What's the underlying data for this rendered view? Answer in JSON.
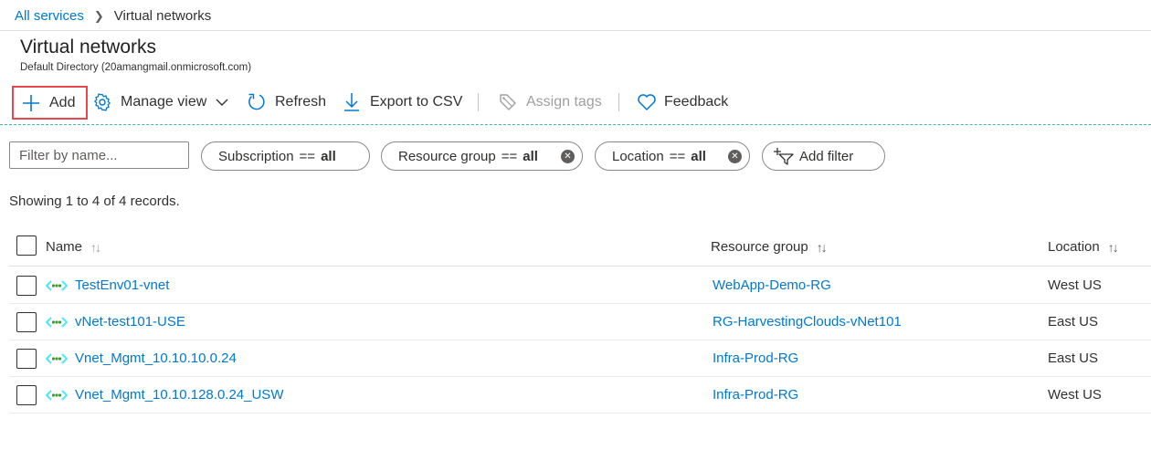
{
  "breadcrumb": {
    "root": "All services",
    "current": "Virtual networks"
  },
  "header": {
    "title": "Virtual networks",
    "subtitle": "Default Directory (20amangmail.onmicrosoft.com)"
  },
  "toolbar": {
    "add": "Add",
    "manage_view": "Manage view",
    "refresh": "Refresh",
    "export": "Export to CSV",
    "assign_tags": "Assign tags",
    "feedback": "Feedback"
  },
  "filters": {
    "name_placeholder": "Filter by name...",
    "subscription": {
      "label": "Subscription",
      "op": "==",
      "value": "all"
    },
    "resource_group": {
      "label": "Resource group",
      "op": "==",
      "value": "all"
    },
    "location": {
      "label": "Location",
      "op": "==",
      "value": "all"
    },
    "add_filter": "Add filter"
  },
  "records_text": "Showing 1 to 4 of 4 records.",
  "columns": {
    "name": "Name",
    "resource_group": "Resource group",
    "location": "Location"
  },
  "rows": [
    {
      "name": "TestEnv01-vnet",
      "resource_group": "WebApp-Demo-RG",
      "location": "West US"
    },
    {
      "name": "vNet-test101-USE",
      "resource_group": "RG-HarvestingClouds-vNet101",
      "location": "East US"
    },
    {
      "name": "Vnet_Mgmt_10.10.10.0.24",
      "resource_group": "Infra-Prod-RG",
      "location": "East US"
    },
    {
      "name": "Vnet_Mgmt_10.10.128.0.24_USW",
      "resource_group": "Infra-Prod-RG",
      "location": "West US"
    }
  ],
  "colors": {
    "link": "#0078d4",
    "highlight": "#e8474e",
    "vnet_icon": "#50e6ff",
    "vnet_dot": "#3f9c35"
  },
  "icons": [
    "plus-icon",
    "gear-icon",
    "chevron-down-icon",
    "refresh-icon",
    "download-icon",
    "tag-icon",
    "heart-icon",
    "close-icon",
    "filter-icon",
    "vnet-icon",
    "sort-icon"
  ]
}
